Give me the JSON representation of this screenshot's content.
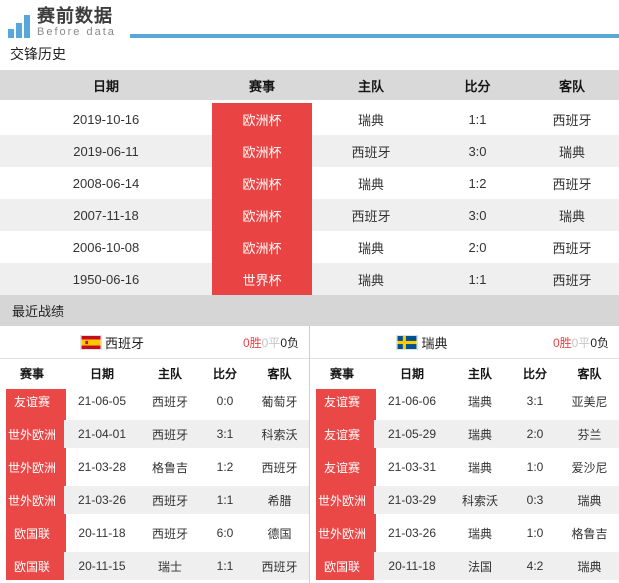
{
  "logo": {
    "title": "赛前数据",
    "subtitle": "Before data"
  },
  "colors": {
    "accent_red": "#ea4343",
    "header_gray": "#d9d9d9",
    "section_bar_gray": "#d6d6d6",
    "alt_row_gray": "#efefef",
    "brand_blue": "#58a7db",
    "record_win_red": "#ea4343",
    "record_draw_gray": "#c6c6c6",
    "record_loss_dark": "#222222"
  },
  "h2h": {
    "section_title": "交锋历史",
    "columns": [
      "日期",
      "赛事",
      "主队",
      "比分",
      "客队"
    ],
    "rows": [
      {
        "date": "2019-10-16",
        "comp": "欧洲杯",
        "home": "瑞典",
        "score": "1:1",
        "away": "西班牙"
      },
      {
        "date": "2019-06-11",
        "comp": "欧洲杯",
        "home": "西班牙",
        "score": "3:0",
        "away": "瑞典"
      },
      {
        "date": "2008-06-14",
        "comp": "欧洲杯",
        "home": "瑞典",
        "score": "1:2",
        "away": "西班牙"
      },
      {
        "date": "2007-11-18",
        "comp": "欧洲杯",
        "home": "西班牙",
        "score": "3:0",
        "away": "瑞典"
      },
      {
        "date": "2006-10-08",
        "comp": "欧洲杯",
        "home": "瑞典",
        "score": "2:0",
        "away": "西班牙"
      },
      {
        "date": "1950-06-16",
        "comp": "世界杯",
        "home": "瑞典",
        "score": "1:1",
        "away": "西班牙"
      }
    ]
  },
  "recent": {
    "section_title": "最近战绩",
    "columns": [
      "赛事",
      "日期",
      "主队",
      "比分",
      "客队"
    ],
    "teams": [
      {
        "name": "西班牙",
        "flag": "spain-flag",
        "record": {
          "wins": "0胜",
          "draws": "0平",
          "losses": "0负"
        },
        "rows": [
          {
            "comp": "友谊赛",
            "date": "21-06-05",
            "home": "西班牙",
            "score": "0:0",
            "away": "葡萄牙"
          },
          {
            "comp": "世外欧洲",
            "date": "21-04-01",
            "home": "西班牙",
            "score": "3:1",
            "away": "科索沃"
          },
          {
            "comp": "世外欧洲",
            "date": "21-03-28",
            "home": "格鲁吉",
            "score": "1:2",
            "away": "西班牙"
          },
          {
            "comp": "世外欧洲",
            "date": "21-03-26",
            "home": "西班牙",
            "score": "1:1",
            "away": "希腊"
          },
          {
            "comp": "欧国联",
            "date": "20-11-18",
            "home": "西班牙",
            "score": "6:0",
            "away": "德国"
          },
          {
            "comp": "欧国联",
            "date": "20-11-15",
            "home": "瑞士",
            "score": "1:1",
            "away": "西班牙"
          }
        ]
      },
      {
        "name": "瑞典",
        "flag": "sweden-flag",
        "record": {
          "wins": "0胜",
          "draws": "0平",
          "losses": "0负"
        },
        "rows": [
          {
            "comp": "友谊赛",
            "date": "21-06-06",
            "home": "瑞典",
            "score": "3:1",
            "away": "亚美尼"
          },
          {
            "comp": "友谊赛",
            "date": "21-05-29",
            "home": "瑞典",
            "score": "2:0",
            "away": "芬兰"
          },
          {
            "comp": "友谊赛",
            "date": "21-03-31",
            "home": "瑞典",
            "score": "1:0",
            "away": "爱沙尼"
          },
          {
            "comp": "世外欧洲",
            "date": "21-03-29",
            "home": "科索沃",
            "score": "0:3",
            "away": "瑞典"
          },
          {
            "comp": "世外欧洲",
            "date": "21-03-26",
            "home": "瑞典",
            "score": "1:0",
            "away": "格鲁吉"
          },
          {
            "comp": "欧国联",
            "date": "20-11-18",
            "home": "法国",
            "score": "4:2",
            "away": "瑞典"
          }
        ]
      }
    ]
  }
}
